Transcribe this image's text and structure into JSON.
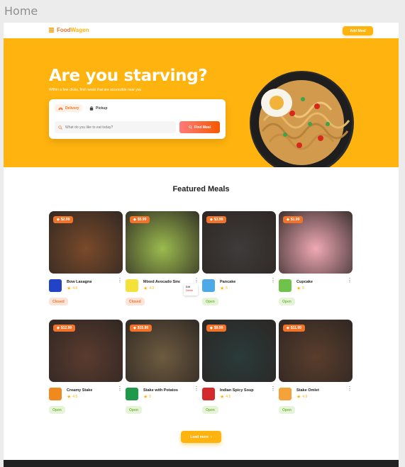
{
  "canvas_title": "Home",
  "brand": {
    "part1": "Food",
    "part2": "Wagen"
  },
  "header": {
    "add_meal_label": "Add Meal"
  },
  "hero": {
    "title": "Are you starving?",
    "subtitle": "Within a few clicks, find meals that are accessible near you",
    "tabs": [
      {
        "label": "Delivery"
      },
      {
        "label": "Pickup"
      }
    ],
    "search_placeholder": "What do you like to eat today?",
    "find_button": "Find Meal"
  },
  "featured": {
    "title": "Featured Meals",
    "meals": [
      {
        "price": "$2.99",
        "name": "Bow Lasagna",
        "rating": "4.6",
        "status": "Closed",
        "brand_color": "#2343c6",
        "img": "#7a4a2a"
      },
      {
        "price": "$5.99",
        "name": "Mixed Avocado Smoothie",
        "rating": "4.0",
        "status": "Closed",
        "brand_color": "#f4e23b",
        "img": "#9bbb4e"
      },
      {
        "price": "$3.99",
        "name": "Pancake",
        "rating": "5",
        "status": "Open",
        "brand_color": "#4da9e8",
        "img": "#3e3b3a"
      },
      {
        "price": "$1.99",
        "name": "Cupcake",
        "rating": "5",
        "status": "Open",
        "brand_color": "#6fc24a",
        "img": "#f0a9b5"
      },
      {
        "price": "$12.99",
        "name": "Creamy Stake",
        "rating": "4.5",
        "status": "Open",
        "brand_color": "#f08a1e",
        "img": "#5b3b2e"
      },
      {
        "price": "$15.99",
        "name": "Stake with Potatos",
        "rating": "5",
        "status": "Open",
        "brand_color": "#1e9a4a",
        "img": "#6e5b40"
      },
      {
        "price": "$9.99",
        "name": "Indian Spicy Soup",
        "rating": "4.5",
        "status": "Open",
        "brand_color": "#d42a2a",
        "img": "#2a3a3a"
      },
      {
        "price": "$11.99",
        "name": "Stake Omlet",
        "rating": "4.9",
        "status": "Open",
        "brand_color": "#f5a23a",
        "img": "#5a3d2c"
      }
    ],
    "menu": {
      "edit": "Edit",
      "delete": "Delete"
    }
  },
  "load_more_label": "Load more"
}
